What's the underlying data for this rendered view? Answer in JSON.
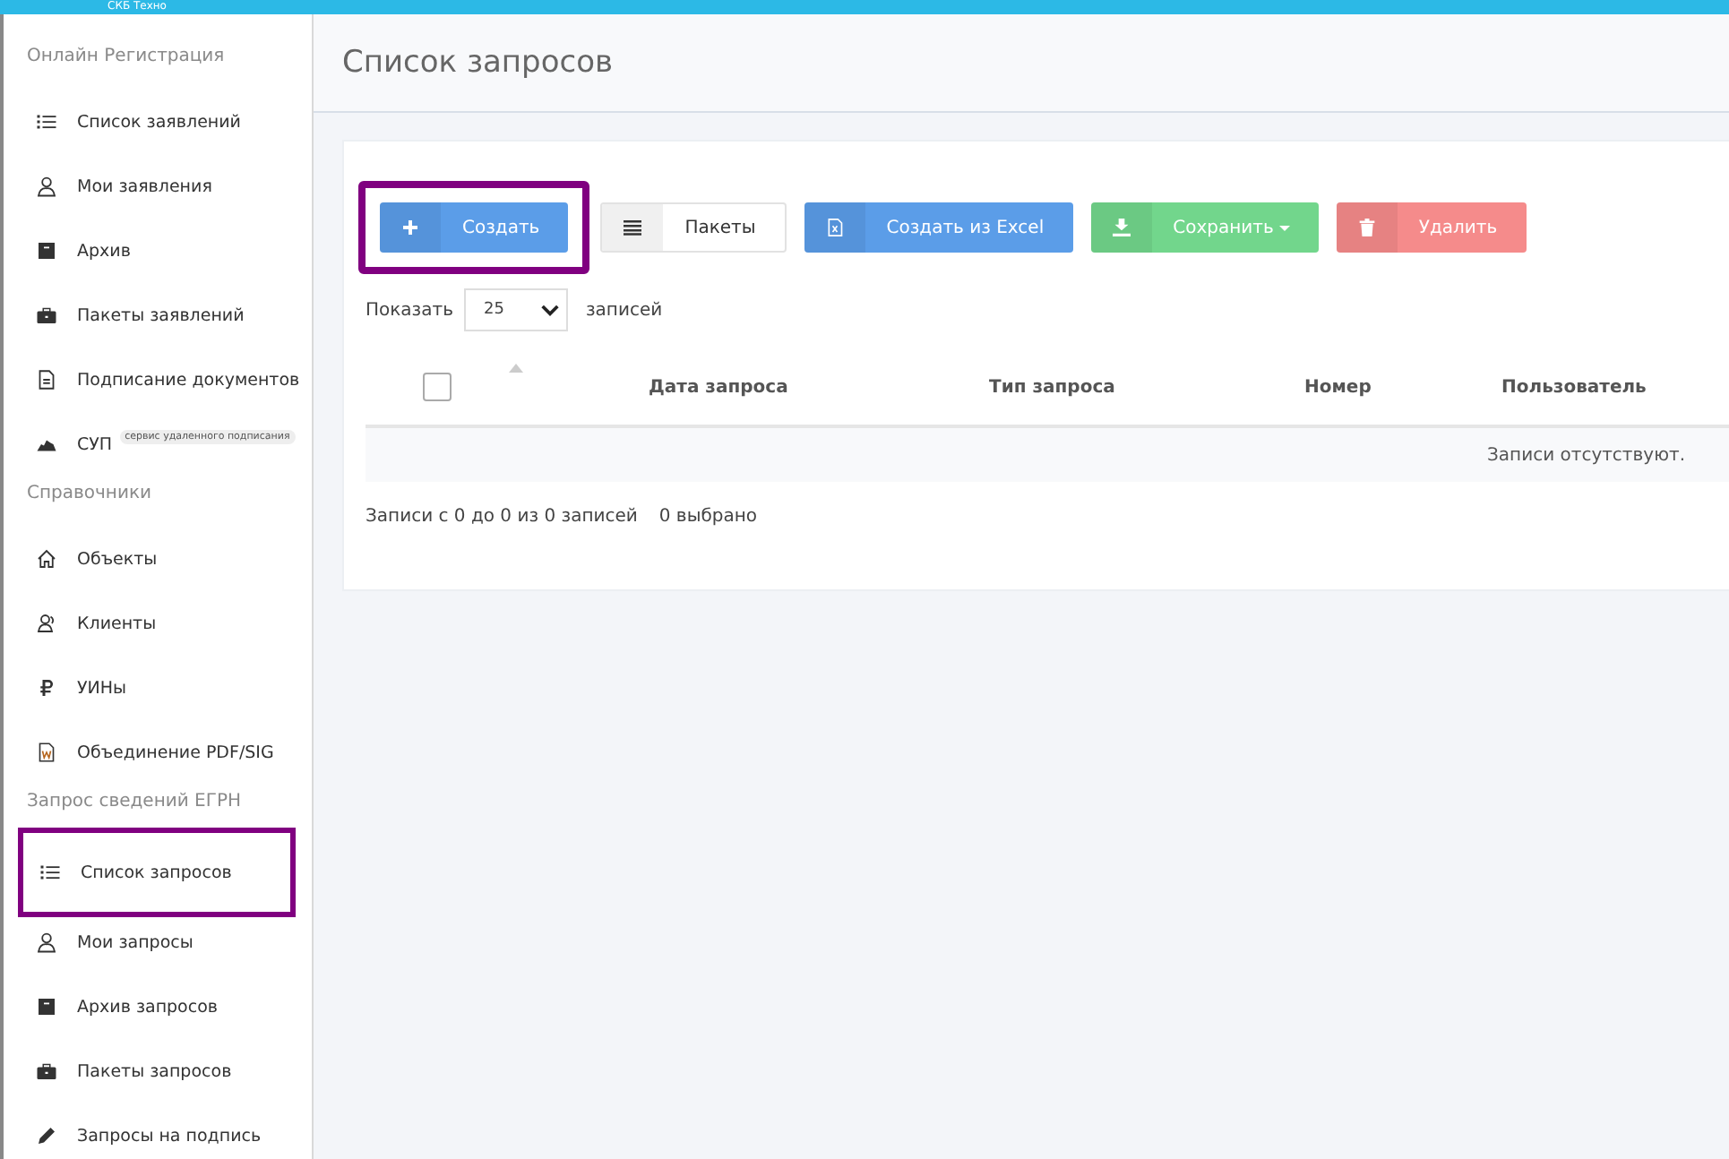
{
  "top_bar": {
    "brand": "СКБ Техно"
  },
  "sidebar": {
    "sections": [
      {
        "title": "Онлайн Регистрация",
        "items": [
          {
            "label": "Список заявлений",
            "kind": "list",
            "highlighted": false
          },
          {
            "label": "Мои заявления",
            "kind": "user",
            "highlighted": false
          },
          {
            "label": "Архив",
            "kind": "archive",
            "highlighted": false
          },
          {
            "label": "Пакеты заявлений",
            "kind": "briefcase",
            "highlighted": false
          },
          {
            "label": "Подписание документов",
            "kind": "document",
            "highlighted": false
          },
          {
            "label": "СУП",
            "kind": "cloud",
            "highlighted": false,
            "badge": "сервис удаленного подписания"
          }
        ]
      },
      {
        "title": "Справочники",
        "items": [
          {
            "label": "Объекты",
            "kind": "home",
            "highlighted": false
          },
          {
            "label": "Клиенты",
            "kind": "users",
            "highlighted": false
          },
          {
            "label": "УИНы",
            "kind": "ruble",
            "highlighted": false
          },
          {
            "label": "Объединение PDF/SIG",
            "kind": "word",
            "highlighted": false
          }
        ]
      },
      {
        "title": "Запрос сведений ЕГРН",
        "items": [
          {
            "label": "Список запросов",
            "kind": "list",
            "highlighted": true
          },
          {
            "label": "Мои запросы",
            "kind": "user",
            "highlighted": false
          },
          {
            "label": "Архив запросов",
            "kind": "archive",
            "highlighted": false
          },
          {
            "label": "Пакеты запросов",
            "kind": "briefcase",
            "highlighted": false
          },
          {
            "label": "Запросы на подпись",
            "kind": "pen",
            "highlighted": false
          }
        ]
      }
    ]
  },
  "page_title": "Список запросов",
  "toolbar": [
    {
      "label": "Создать",
      "kind": "create",
      "highlighted": true
    },
    {
      "label": "Пакеты",
      "kind": "packages",
      "highlighted": false
    },
    {
      "label": "Создать из Excel",
      "kind": "excel",
      "highlighted": false
    },
    {
      "label": "Сохранить",
      "kind": "save",
      "highlighted": false
    },
    {
      "label": "Удалить",
      "kind": "delete",
      "highlighted": false
    }
  ],
  "page_length": {
    "prefix": "Показать",
    "value": "25",
    "suffix": "записей"
  },
  "table": {
    "select_all": {
      "checked": false
    },
    "columns": [
      "Дата запроса",
      "Тип запроса",
      "Номер",
      "Пользователь"
    ],
    "empty_text": "Записи отсутствуют."
  },
  "footer": {
    "info": "Записи с 0 до 0 из 0 записей",
    "selected": "0 выбрано"
  }
}
